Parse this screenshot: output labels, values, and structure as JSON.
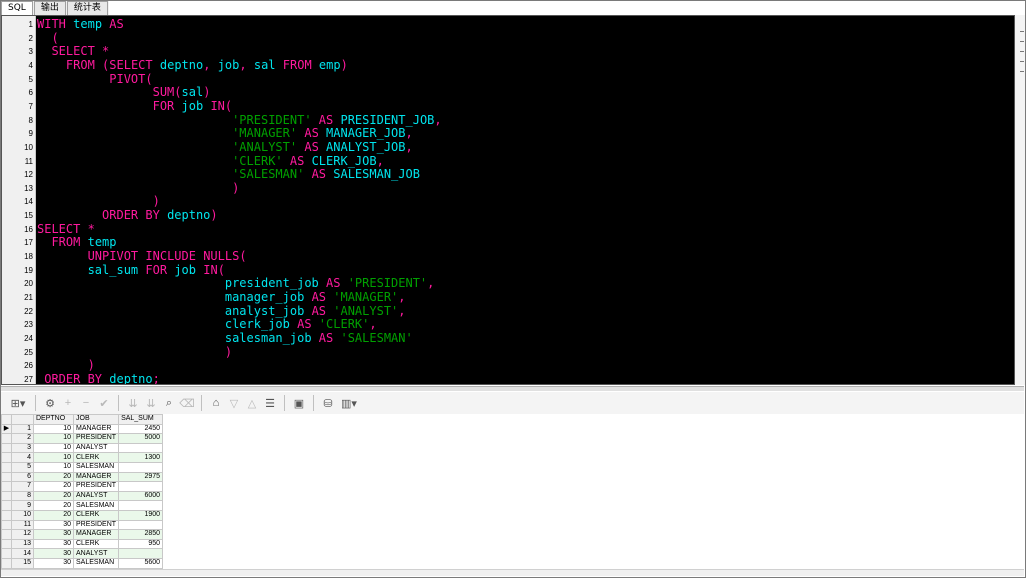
{
  "tabs": [
    {
      "label": "SQL",
      "active": true
    },
    {
      "label": "输出",
      "active": false
    },
    {
      "label": "统计表",
      "active": false
    }
  ],
  "editor": {
    "lines": [
      [
        [
          "WITH",
          "kw"
        ],
        [
          " "
        ],
        [
          "temp",
          "id"
        ],
        [
          " "
        ],
        [
          "AS",
          "kw"
        ]
      ],
      [
        [
          "  "
        ],
        [
          "(",
          "pun"
        ]
      ],
      [
        [
          "  "
        ],
        [
          "SELECT",
          "kw"
        ],
        [
          " "
        ],
        [
          "*",
          "pun"
        ]
      ],
      [
        [
          "    "
        ],
        [
          "FROM",
          "kw"
        ],
        [
          " "
        ],
        [
          "(",
          "pun"
        ],
        [
          "SELECT",
          "kw"
        ],
        [
          " "
        ],
        [
          "deptno",
          "id"
        ],
        [
          ",",
          "pun"
        ],
        [
          " "
        ],
        [
          "job",
          "id"
        ],
        [
          ",",
          "pun"
        ],
        [
          " "
        ],
        [
          "sal",
          "id"
        ],
        [
          " "
        ],
        [
          "FROM",
          "kw"
        ],
        [
          " "
        ],
        [
          "emp",
          "id"
        ],
        [
          ")",
          "pun"
        ]
      ],
      [
        [
          "          "
        ],
        [
          "PIVOT",
          "kw"
        ],
        [
          "(",
          "pun"
        ]
      ],
      [
        [
          "                "
        ],
        [
          "SUM",
          "kw"
        ],
        [
          "(",
          "pun"
        ],
        [
          "sal",
          "id"
        ],
        [
          ")",
          "pun"
        ]
      ],
      [
        [
          "                "
        ],
        [
          "FOR",
          "kw"
        ],
        [
          " "
        ],
        [
          "job",
          "id"
        ],
        [
          " "
        ],
        [
          "IN",
          "kw"
        ],
        [
          "(",
          "pun"
        ]
      ],
      [
        [
          "                           "
        ],
        [
          "'PRESIDENT'",
          "str"
        ],
        [
          " "
        ],
        [
          "AS",
          "kw"
        ],
        [
          " "
        ],
        [
          "PRESIDENT_JOB",
          "id"
        ],
        [
          ",",
          "pun"
        ]
      ],
      [
        [
          "                           "
        ],
        [
          "'MANAGER'",
          "str"
        ],
        [
          " "
        ],
        [
          "AS",
          "kw"
        ],
        [
          " "
        ],
        [
          "MANAGER_JOB",
          "id"
        ],
        [
          ",",
          "pun"
        ]
      ],
      [
        [
          "                           "
        ],
        [
          "'ANALYST'",
          "str"
        ],
        [
          " "
        ],
        [
          "AS",
          "kw"
        ],
        [
          " "
        ],
        [
          "ANALYST_JOB",
          "id"
        ],
        [
          ",",
          "pun"
        ]
      ],
      [
        [
          "                           "
        ],
        [
          "'CLERK'",
          "str"
        ],
        [
          " "
        ],
        [
          "AS",
          "kw"
        ],
        [
          " "
        ],
        [
          "CLERK_JOB",
          "id"
        ],
        [
          ",",
          "pun"
        ]
      ],
      [
        [
          "                           "
        ],
        [
          "'SALESMAN'",
          "str"
        ],
        [
          " "
        ],
        [
          "AS",
          "kw"
        ],
        [
          " "
        ],
        [
          "SALESMAN_JOB",
          "id"
        ]
      ],
      [
        [
          "                           "
        ],
        [
          ")",
          "pun"
        ]
      ],
      [
        [
          "                "
        ],
        [
          ")",
          "pun"
        ]
      ],
      [
        [
          "         "
        ],
        [
          "ORDER BY",
          "kw"
        ],
        [
          " "
        ],
        [
          "deptno",
          "id"
        ],
        [
          ")",
          "pun"
        ]
      ],
      [
        [
          "SELECT",
          "kw"
        ],
        [
          " "
        ],
        [
          "*",
          "pun"
        ]
      ],
      [
        [
          "  "
        ],
        [
          "FROM",
          "kw"
        ],
        [
          " "
        ],
        [
          "temp",
          "id"
        ]
      ],
      [
        [
          "       "
        ],
        [
          "UNPIVOT",
          "kw"
        ],
        [
          " "
        ],
        [
          "INCLUDE",
          "kw"
        ],
        [
          " "
        ],
        [
          "NULLS",
          "kw"
        ],
        [
          "(",
          "pun"
        ]
      ],
      [
        [
          "       "
        ],
        [
          "sal_sum",
          "id"
        ],
        [
          " "
        ],
        [
          "FOR",
          "kw"
        ],
        [
          " "
        ],
        [
          "job",
          "id"
        ],
        [
          " "
        ],
        [
          "IN",
          "kw"
        ],
        [
          "(",
          "pun"
        ]
      ],
      [
        [
          "                          "
        ],
        [
          "president_job",
          "id"
        ],
        [
          " "
        ],
        [
          "AS",
          "kw"
        ],
        [
          " "
        ],
        [
          "'PRESIDENT'",
          "str"
        ],
        [
          ",",
          "pun"
        ]
      ],
      [
        [
          "                          "
        ],
        [
          "manager_job",
          "id"
        ],
        [
          " "
        ],
        [
          "AS",
          "kw"
        ],
        [
          " "
        ],
        [
          "'MANAGER'",
          "str"
        ],
        [
          ",",
          "pun"
        ]
      ],
      [
        [
          "                          "
        ],
        [
          "analyst_job",
          "id"
        ],
        [
          " "
        ],
        [
          "AS",
          "kw"
        ],
        [
          " "
        ],
        [
          "'ANALYST'",
          "str"
        ],
        [
          ",",
          "pun"
        ]
      ],
      [
        [
          "                          "
        ],
        [
          "clerk_job",
          "id"
        ],
        [
          " "
        ],
        [
          "AS",
          "kw"
        ],
        [
          " "
        ],
        [
          "'CLERK'",
          "str"
        ],
        [
          ",",
          "pun"
        ]
      ],
      [
        [
          "                          "
        ],
        [
          "salesman_job",
          "id"
        ],
        [
          " "
        ],
        [
          "AS",
          "kw"
        ],
        [
          " "
        ],
        [
          "'SALESMAN'",
          "str"
        ]
      ],
      [
        [
          "                          "
        ],
        [
          ")",
          "pun"
        ]
      ],
      [
        [
          "       "
        ],
        [
          ")",
          "pun"
        ]
      ],
      [
        [
          " "
        ],
        [
          "ORDER BY",
          "kw"
        ],
        [
          " "
        ],
        [
          "deptno",
          "id"
        ],
        [
          ";",
          "pun"
        ]
      ]
    ]
  },
  "toolbar": {
    "icons": [
      {
        "name": "grid-view-icon",
        "glyph": "⊞▾",
        "enabled": true
      },
      {
        "sep": true
      },
      {
        "name": "lock-icon",
        "glyph": "⚙",
        "enabled": true
      },
      {
        "name": "add-record-icon",
        "glyph": "+",
        "enabled": false
      },
      {
        "name": "delete-record-icon",
        "glyph": "−",
        "enabled": false
      },
      {
        "name": "post-changes-icon",
        "glyph": "✔",
        "enabled": false
      },
      {
        "sep": true
      },
      {
        "name": "fetch-next-icon",
        "glyph": "⇊",
        "enabled": false
      },
      {
        "name": "fetch-all-icon",
        "glyph": "⇊",
        "enabled": false
      },
      {
        "name": "find-icon",
        "glyph": "⌕",
        "enabled": true
      },
      {
        "name": "clear-icon",
        "glyph": "⌫",
        "enabled": false
      },
      {
        "sep": true
      },
      {
        "name": "query-by-example-icon",
        "glyph": "⌂",
        "enabled": true
      },
      {
        "name": "filter-down-icon",
        "glyph": "▽",
        "enabled": false
      },
      {
        "name": "filter-up-icon",
        "glyph": "△",
        "enabled": false
      },
      {
        "name": "single-record-view-icon",
        "glyph": "☰",
        "enabled": true
      },
      {
        "sep": true
      },
      {
        "name": "save-icon",
        "glyph": "▣",
        "enabled": true
      },
      {
        "sep": true
      },
      {
        "name": "export-icon",
        "glyph": "⛁",
        "enabled": true
      },
      {
        "name": "chart-icon",
        "glyph": "▥▾",
        "enabled": true
      }
    ]
  },
  "grid": {
    "columns": [
      "DEPTNO",
      "JOB",
      "SAL_SUM"
    ],
    "rows": [
      [
        "1",
        "10",
        "MANAGER",
        "2450"
      ],
      [
        "2",
        "10",
        "PRESIDENT",
        "5000"
      ],
      [
        "3",
        "10",
        "ANALYST",
        ""
      ],
      [
        "4",
        "10",
        "CLERK",
        "1300"
      ],
      [
        "5",
        "10",
        "SALESMAN",
        ""
      ],
      [
        "6",
        "20",
        "MANAGER",
        "2975"
      ],
      [
        "7",
        "20",
        "PRESIDENT",
        ""
      ],
      [
        "8",
        "20",
        "ANALYST",
        "6000"
      ],
      [
        "9",
        "20",
        "SALESMAN",
        ""
      ],
      [
        "10",
        "20",
        "CLERK",
        "1900"
      ],
      [
        "11",
        "30",
        "PRESIDENT",
        ""
      ],
      [
        "12",
        "30",
        "MANAGER",
        "2850"
      ],
      [
        "13",
        "30",
        "CLERK",
        "950"
      ],
      [
        "14",
        "30",
        "ANALYST",
        ""
      ],
      [
        "15",
        "30",
        "SALESMAN",
        "5600"
      ]
    ],
    "current_row_indicator": "▶"
  },
  "colors": {
    "keyword": "#ff1a9e",
    "identifier": "#00e5ee",
    "string": "#00a000",
    "editor_background": "#000000",
    "row_alt": "#eaf8ea"
  }
}
